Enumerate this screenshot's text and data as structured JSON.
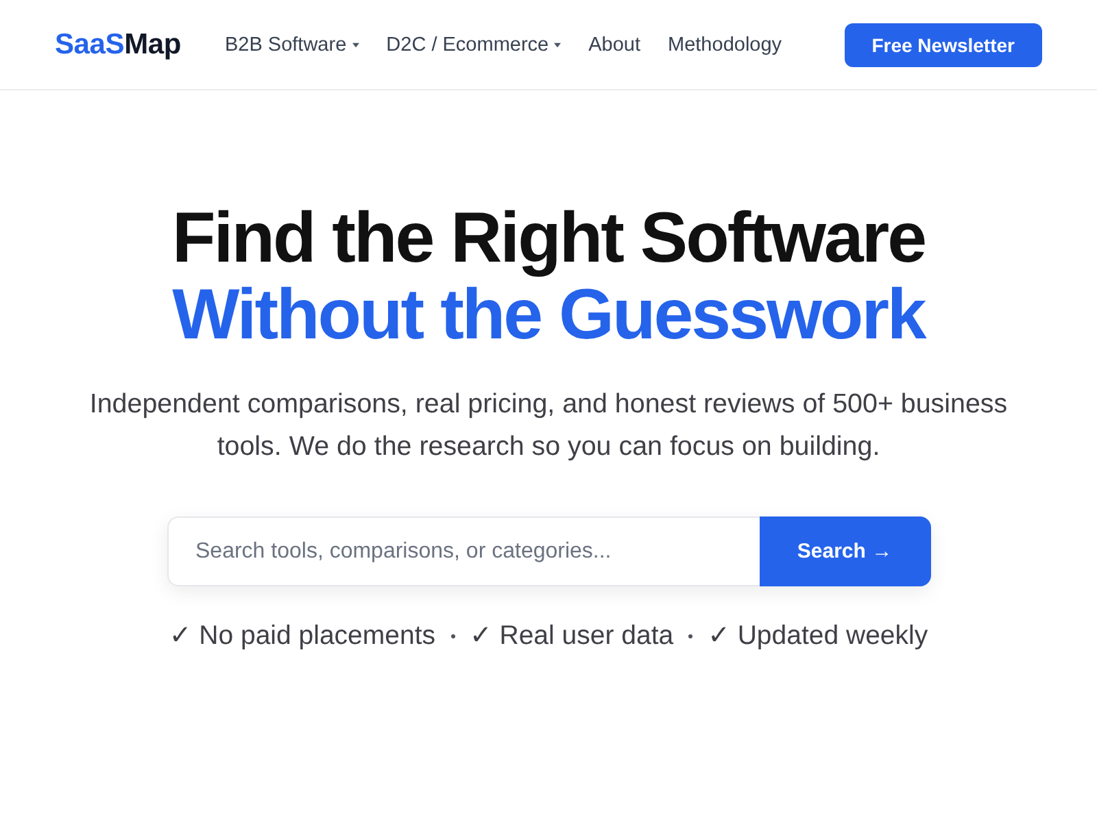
{
  "header": {
    "logo": [
      {
        "text": "SaaS",
        "accent": true
      },
      {
        "text": "Map",
        "accent": false
      }
    ],
    "nav": [
      {
        "label": "B2B Software",
        "has_menu": true
      },
      {
        "label": "D2C / Ecommerce",
        "has_menu": true
      },
      {
        "label": "About",
        "has_menu": false
      },
      {
        "label": "Methodology",
        "has_menu": false
      }
    ],
    "cta": "Free Newsletter"
  },
  "hero": {
    "headline": [
      {
        "text": "Find the Right Software",
        "accent": false
      },
      {
        "text": "Without the Guesswork",
        "accent": true
      }
    ],
    "subtitle": "Independent comparisons, real pricing, and honest reviews of 500+ business tools. We do the research so you can focus on building.",
    "search": {
      "placeholder": "Search tools, comparisons, or categories...",
      "button": "Search →"
    },
    "trust_points": [
      "✓ No paid placements",
      "✓ Real user data",
      "✓ Updated weekly"
    ]
  }
}
